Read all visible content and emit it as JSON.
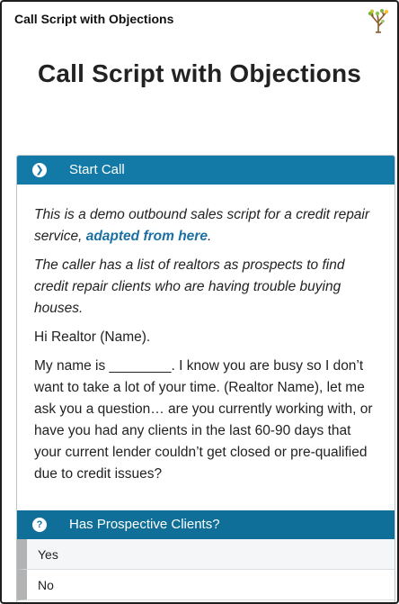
{
  "app": {
    "window_title": "Call Script with Objections"
  },
  "page": {
    "title": "Call Script with Objections"
  },
  "start_step": {
    "icon": "chevron-right-circle-icon",
    "label": "Start Call",
    "intro_part1": "This is a demo outbound sales script for a credit repair service, ",
    "intro_link": "adapted from here",
    "intro_part2": ".",
    "context": "The caller has a list of realtors as prospects to find credit repair clients who are having trouble buying houses.",
    "greeting": "Hi Realtor (Name).",
    "pitch": "My name is ________.  I know you are busy so I don’t want to take a lot of your time.  (Realtor Name), let me ask you a question… are you currently working with, or have you had any clients in the last 60-90 days that your current lender couldn’t get closed or pre-qualified due to credit issues?"
  },
  "question_step": {
    "icon": "question-circle-icon",
    "label": "Has Prospective Clients?",
    "answers": [
      "Yes",
      "No"
    ]
  },
  "colors": {
    "step_header": "#1379a6",
    "link": "#1a6fa3",
    "answer_bar": "#b3b3b3"
  }
}
